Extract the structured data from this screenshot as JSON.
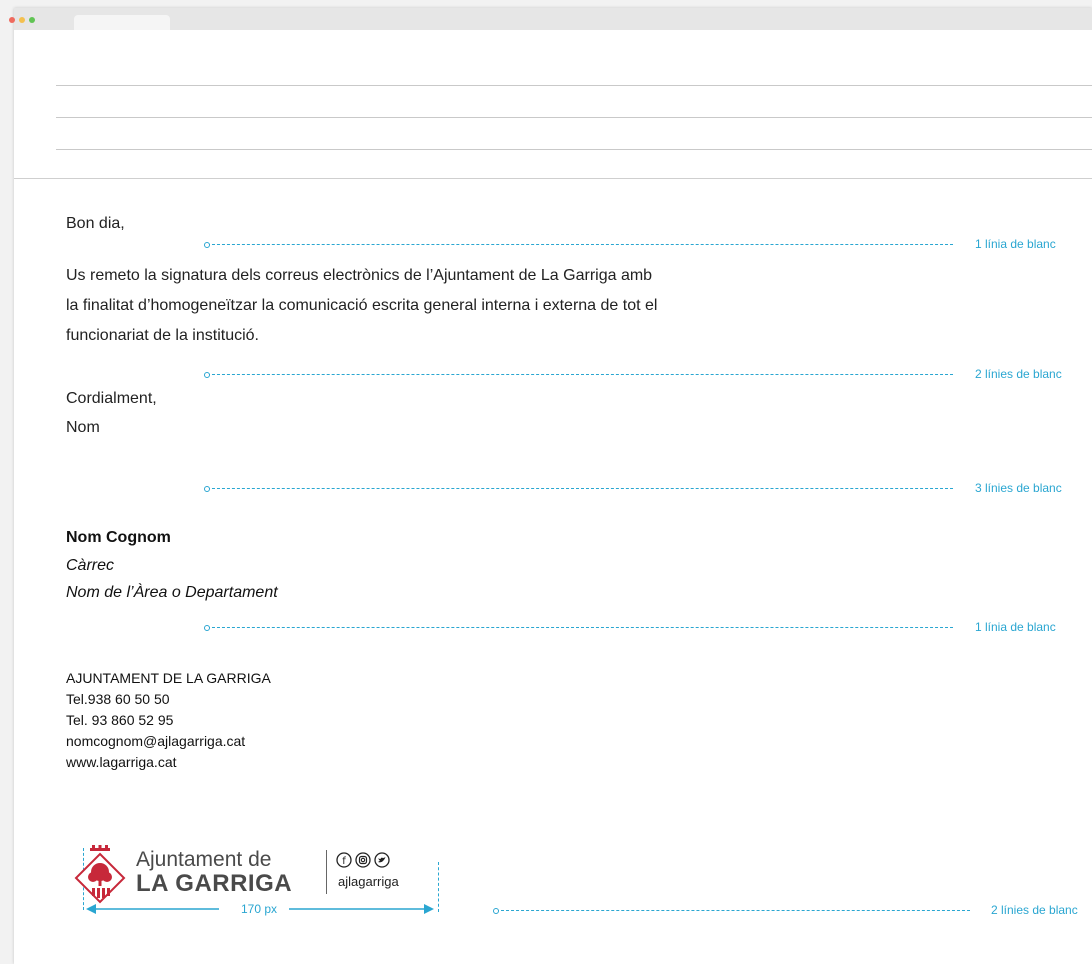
{
  "email": {
    "greeting": "Bon dia,",
    "body_line1": "Us remeto la signatura dels correus electrònics de l’Ajuntament de La Garriga amb",
    "body_line2": "la finalitat d’homogeneïtzar la comunicació escrita general interna i externa de tot el",
    "body_line3": "funcionariat de la institució.",
    "closing": "Cordialment,",
    "name_short": "Nom"
  },
  "signature": {
    "full_name": "Nom Cognom",
    "role": "Càrrec",
    "department": "Nom de l’Àrea o Departament"
  },
  "contact": {
    "org": "AJUNTAMENT DE LA GARRIGA",
    "tel1": "Tel.938 60 50 50",
    "tel2": "Tel. 93 860 52 95",
    "email": "nomcognom@ajlagarriga.cat",
    "web": "www.lagarriga.cat"
  },
  "guides": [
    "1 línia de blanc",
    "2 línies de blanc",
    "3 línies de blanc",
    "1 línia de blanc",
    "2 línies de blanc"
  ],
  "logo": {
    "line1": "Ajuntament de",
    "line2": "LA GARRIGA",
    "handle": "ajlagarriga",
    "social_icons": [
      "facebook-icon",
      "instagram-icon",
      "twitter-icon"
    ]
  },
  "dimension": {
    "width_label": "170 px"
  },
  "colors": {
    "guide": "#2aa6d1",
    "logo_red": "#c7283a",
    "text": "#222222"
  }
}
